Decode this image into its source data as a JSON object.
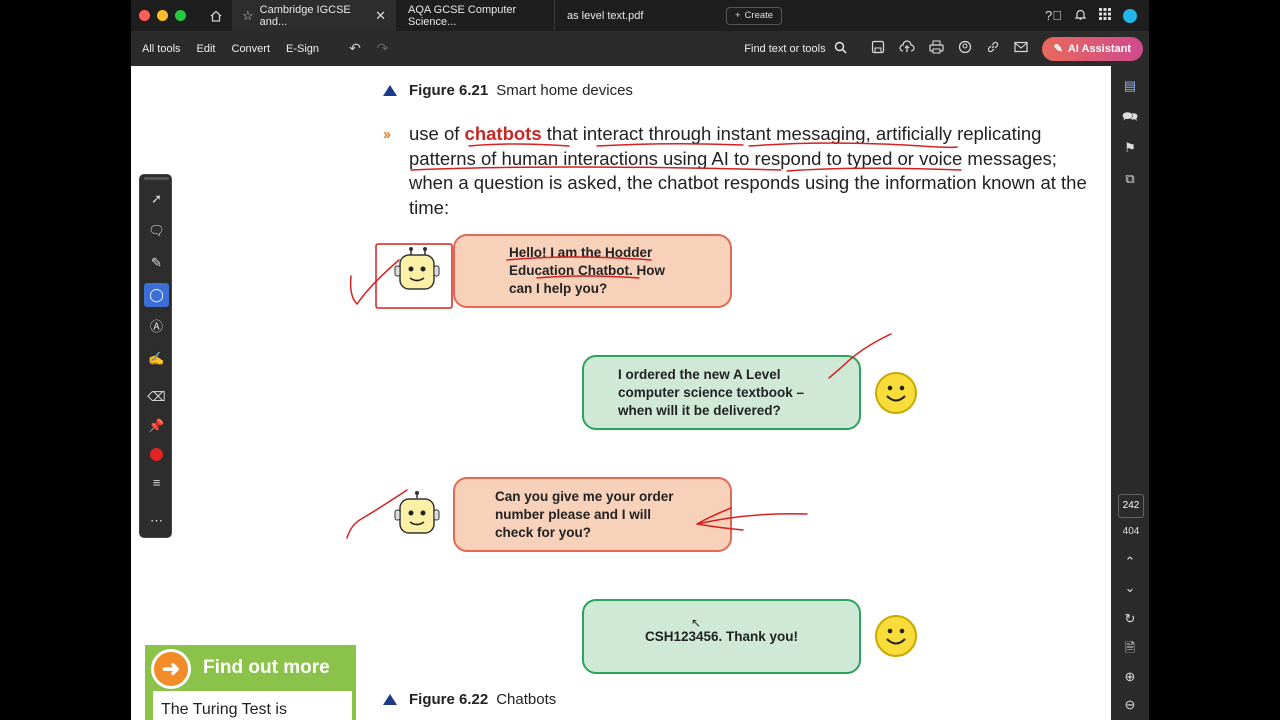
{
  "tabs": {
    "active": "Cambridge IGCSE and...",
    "second": "AQA GCSE Computer Science...",
    "third": "as level text.pdf",
    "create": "Create"
  },
  "toolbar": {
    "all_tools": "All tools",
    "edit": "Edit",
    "convert": "Convert",
    "esign": "E-Sign",
    "find": "Find text or tools",
    "ai_assistant": "AI Assistant"
  },
  "page_nav": {
    "current": "242",
    "total": "404"
  },
  "document": {
    "fig21": {
      "label": "Figure 6.21",
      "title": "Smart home devices"
    },
    "para": {
      "pre": "use of ",
      "keyword": "chatbots",
      "post": " that interact through instant messaging, artificially replicating patterns of human interactions using AI to respond to typed or voice messages; when a question is asked, the chatbot responds using the information known at the time:"
    },
    "chat": [
      "Hello! I am the Hodder Education Chatbot. How can I help you?",
      "I ordered the new A Level computer science textbook – when will it be delivered?",
      "Can you give me your order number please and I will check for you?",
      "CSH123456. Thank you!"
    ],
    "fig22": {
      "label": "Figure 6.22",
      "title": "Chatbots"
    },
    "find_out_more": {
      "title": "Find out more",
      "body": "The Turing Test is"
    }
  },
  "colors": {
    "accent_blue": "#3b6fd6",
    "bot_bubble": "#f8d1bb",
    "user_bubble": "#cfe9d6",
    "keyword_red": "#c62828",
    "annotation_red": "#d62020"
  }
}
